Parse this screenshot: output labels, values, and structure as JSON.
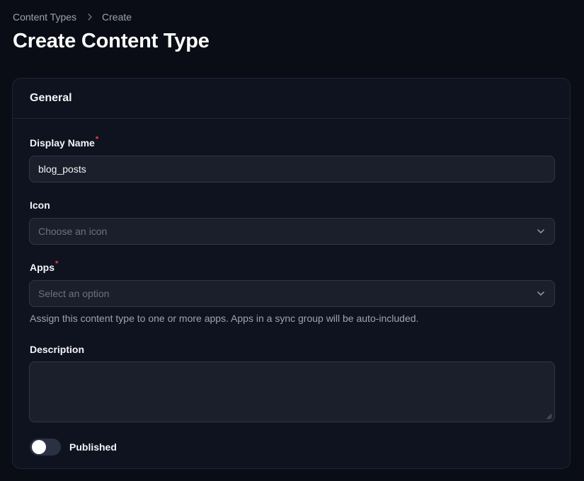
{
  "breadcrumb": {
    "items": [
      "Content Types",
      "Create"
    ]
  },
  "page_title": "Create Content Type",
  "card": {
    "title": "General",
    "display_name": {
      "label": "Display Name",
      "required_mark": "*",
      "value": "blog_posts"
    },
    "icon": {
      "label": "Icon",
      "placeholder": "Choose an icon"
    },
    "apps": {
      "label": "Apps",
      "required_mark": "*",
      "placeholder": "Select an option",
      "hint": "Assign this content type to one or more apps. Apps in a sync group will be auto-included."
    },
    "description": {
      "label": "Description",
      "value": ""
    },
    "published": {
      "label": "Published",
      "enabled": false
    }
  },
  "icons": {
    "breadcrumb_separator": "chevron-right-icon",
    "select_indicator": "chevron-down-icon",
    "textarea_resize": "resize-handle-icon"
  },
  "colors": {
    "background": "#0a0d16",
    "card": "#0f1320",
    "field": "#1b1f2b",
    "required": "#ef4444",
    "toggle_off": "#2a3142"
  }
}
